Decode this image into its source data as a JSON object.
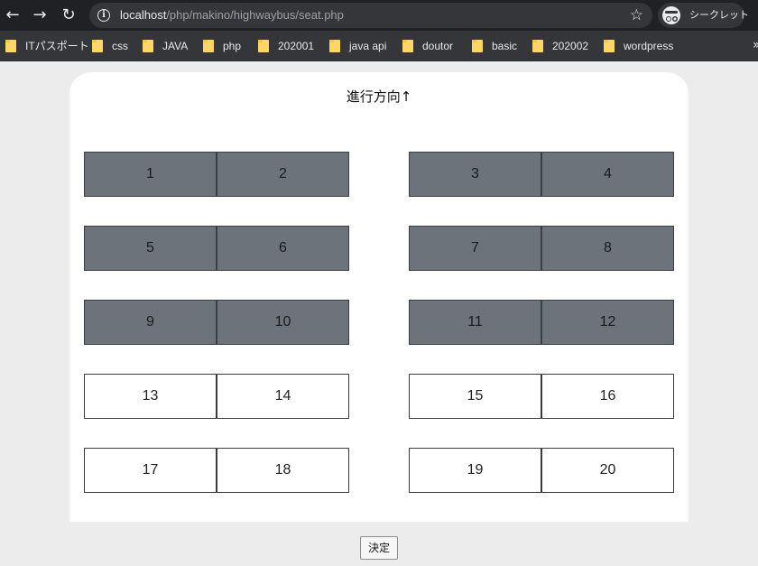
{
  "browser": {
    "url_host": "localhost",
    "url_path": "/php/makino/highwaybus/seat.php",
    "incognito_label": "シークレット",
    "bookmarks": [
      "ITパスポート",
      "css",
      "JAVA",
      "php",
      "202001",
      "java api",
      "doutor",
      "basic",
      "202002",
      "wordpress"
    ]
  },
  "page": {
    "direction_label": "進行方向↑",
    "submit_label": "決定",
    "seats": [
      {
        "number": "1",
        "status": "taken"
      },
      {
        "number": "2",
        "status": "taken"
      },
      {
        "number": "3",
        "status": "taken"
      },
      {
        "number": "4",
        "status": "taken"
      },
      {
        "number": "5",
        "status": "taken"
      },
      {
        "number": "6",
        "status": "taken"
      },
      {
        "number": "7",
        "status": "taken"
      },
      {
        "number": "8",
        "status": "taken"
      },
      {
        "number": "9",
        "status": "taken"
      },
      {
        "number": "10",
        "status": "taken"
      },
      {
        "number": "11",
        "status": "taken"
      },
      {
        "number": "12",
        "status": "taken"
      },
      {
        "number": "13",
        "status": "available"
      },
      {
        "number": "14",
        "status": "available"
      },
      {
        "number": "15",
        "status": "available"
      },
      {
        "number": "16",
        "status": "available"
      },
      {
        "number": "17",
        "status": "available"
      },
      {
        "number": "18",
        "status": "available"
      },
      {
        "number": "19",
        "status": "available"
      },
      {
        "number": "20",
        "status": "available"
      }
    ]
  },
  "colors": {
    "taken_seat": "#6c737a",
    "available_seat": "#ffffff",
    "page_background": "#ececec"
  }
}
